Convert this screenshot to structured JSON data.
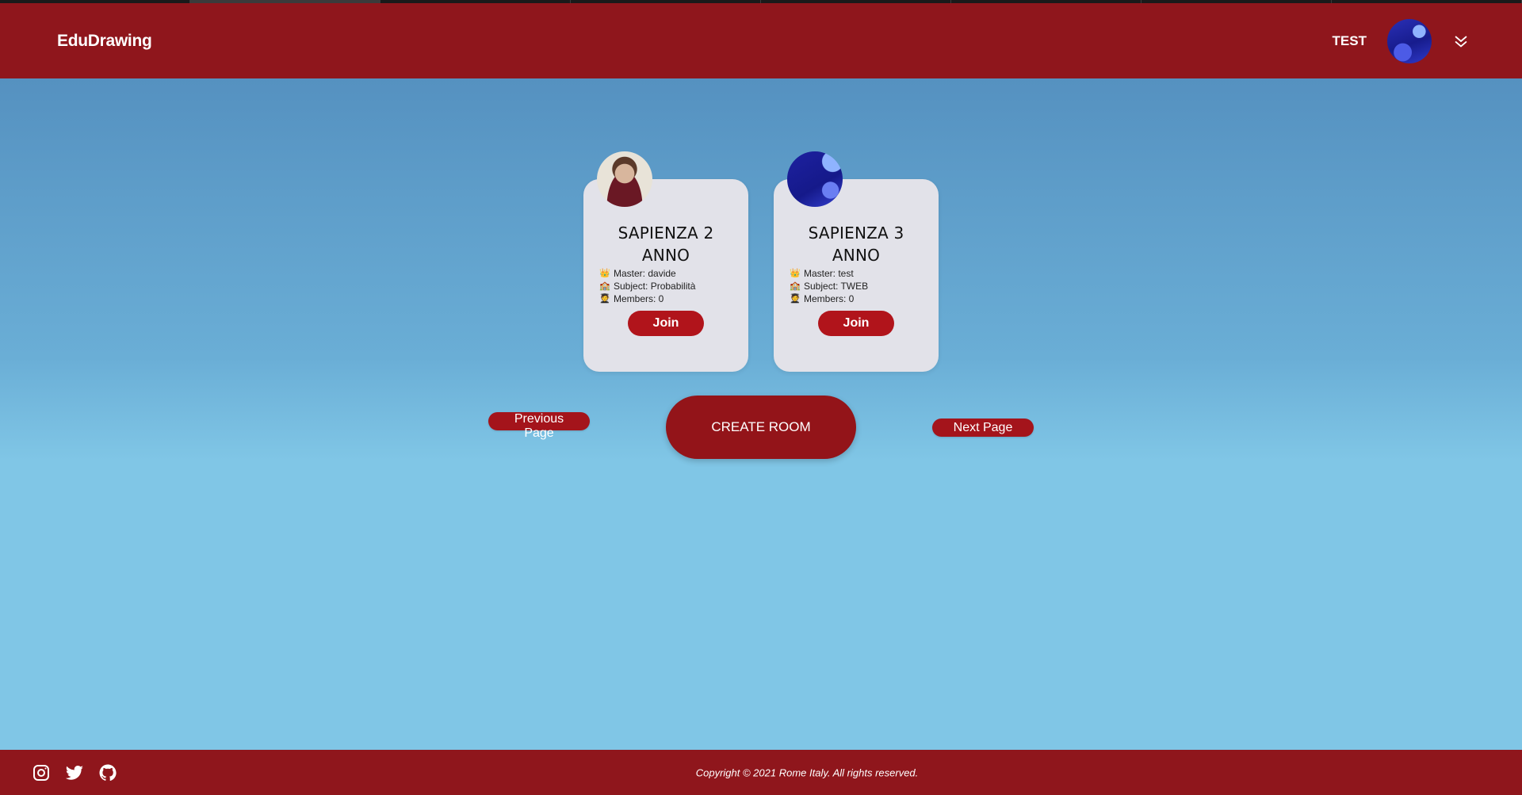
{
  "app": {
    "brand": "EduDrawing"
  },
  "header": {
    "username": "TEST"
  },
  "rooms": [
    {
      "title": "SAPIENZA 2 ANNO",
      "master_label": "Master: davide",
      "subject_label": "Subject: Probabilità",
      "members_label": "Members: 0",
      "join_label": "Join",
      "avatar": "person-photo"
    },
    {
      "title": "SAPIENZA 3 ANNO",
      "master_label": "Master: test",
      "subject_label": "Subject: TWEB",
      "members_label": "Members: 0",
      "join_label": "Join",
      "avatar": "planet-avatar"
    }
  ],
  "pager": {
    "prev_label": "Previous Page",
    "next_label": "Next Page",
    "create_label": "CREATE ROOM"
  },
  "footer": {
    "copyright": "Copyright © 2021 Rome Italy. All rights reserved.",
    "social_icons": [
      "instagram-icon",
      "twitter-icon",
      "github-icon"
    ]
  },
  "colors": {
    "navbar": "#8f161c",
    "button": "#b1141b",
    "card": "#e2e2e9",
    "bg_top": "#4f89ba",
    "bg_bottom": "#80c6e6"
  }
}
